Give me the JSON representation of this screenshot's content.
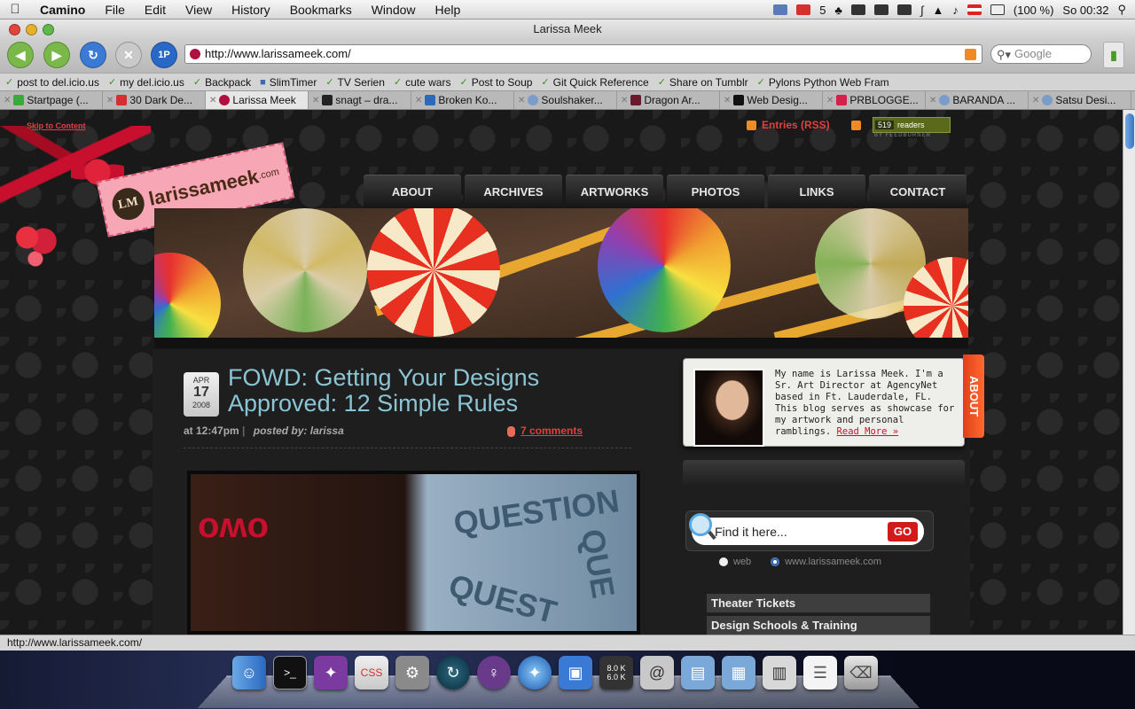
{
  "menubar": {
    "app": "Camino",
    "items": [
      "File",
      "Edit",
      "View",
      "History",
      "Bookmarks",
      "Window",
      "Help"
    ],
    "mail_count": "5",
    "battery": "(100 %)",
    "clock": "So 00:32"
  },
  "window": {
    "title": "Larissa Meek"
  },
  "toolbar": {
    "url": "http://www.larissameek.com/",
    "search_placeholder": "Google",
    "icons": [
      "back-arrow-icon",
      "forward-arrow-icon",
      "reload-icon",
      "stop-icon",
      "1password-icon"
    ]
  },
  "bookmarks": [
    "post to del.icio.us",
    "my del.icio.us",
    "Backpack",
    "SlimTimer",
    "TV Serien",
    "cute wars",
    "Post to Soup",
    "Git Quick Reference",
    "Share on Tumblr",
    "Pylons Python Web Fram"
  ],
  "tabs": [
    {
      "label": "Startpage (..."
    },
    {
      "label": "30 Dark De..."
    },
    {
      "label": "Larissa Meek",
      "active": true
    },
    {
      "label": "snagt – dra..."
    },
    {
      "label": "Broken Ko..."
    },
    {
      "label": "Soulshaker..."
    },
    {
      "label": "Dragon Ar..."
    },
    {
      "label": "Web Desig..."
    },
    {
      "label": "PRBLOGGE..."
    },
    {
      "label": "BARANDA ..."
    },
    {
      "label": "Satsu Desi..."
    }
  ],
  "page": {
    "skip_link": "Skip to Content",
    "rss_label": "Entries (RSS)",
    "feed_count": "519",
    "feed_label": "readers",
    "feed_by": "BY FEEDBURNER",
    "logo": {
      "initials": "LM",
      "name": "larissameek",
      "tld": ".com"
    },
    "nav": [
      "ABOUT",
      "ARCHIVES",
      "ARTWORKS",
      "PHOTOS",
      "LINKS",
      "CONTACT"
    ],
    "post": {
      "month": "APR",
      "day": "17",
      "year": "2008",
      "title": "FOWD: Getting Your Designs Approved: 12 Simple Rules",
      "time": "at 12:47pm",
      "posted_by": "posted by: larissa",
      "comments": "7 comments",
      "photo_words": [
        "QUESTION",
        "QUE",
        "QUEST"
      ]
    },
    "about": {
      "tab": "ABOUT",
      "text": "My name is Larissa Meek. I'm a Sr. Art Director at AgencyNet based in Ft. Lauderdale, FL. This blog serves as showcase for my artwork and personal ramblings.",
      "read_more": "Read More »"
    },
    "search": {
      "placeholder": "Find it here...",
      "go": "GO",
      "option_web": "web",
      "option_site": "www.larissameek.com"
    },
    "sidebar_links": [
      "Theater Tickets",
      "Design Schools & Training"
    ]
  },
  "statusbar": {
    "url": "http://www.larissameek.com/"
  },
  "dock": {
    "volume_labels": [
      "8.0 K",
      "6.0 K"
    ]
  }
}
